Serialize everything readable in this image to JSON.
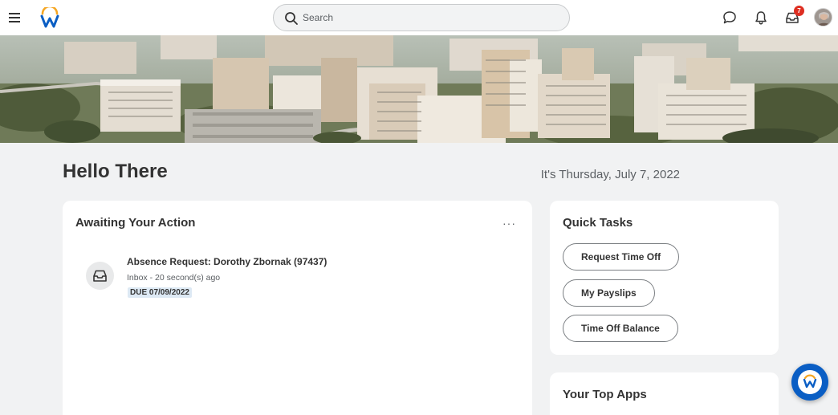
{
  "search": {
    "placeholder": "Search"
  },
  "header": {
    "inbox_badge": "7"
  },
  "greeting": {
    "title": "Hello There",
    "date": "It's Thursday, July 7, 2022"
  },
  "awaiting": {
    "title": "Awaiting Your Action",
    "item_title": "Absence Request: Dorothy Zbornak (97437)",
    "item_sub": "Inbox - 20 second(s) ago",
    "item_due": "DUE 07/09/2022"
  },
  "quick_tasks": {
    "title": "Quick Tasks",
    "buttons": [
      "Request Time Off",
      "My Payslips",
      "Time Off Balance"
    ]
  },
  "top_apps": {
    "title": "Your Top Apps"
  },
  "colors": {
    "brand_blue": "#0a5ec4",
    "brand_orange": "#f5a623",
    "badge_red": "#de2e21"
  }
}
